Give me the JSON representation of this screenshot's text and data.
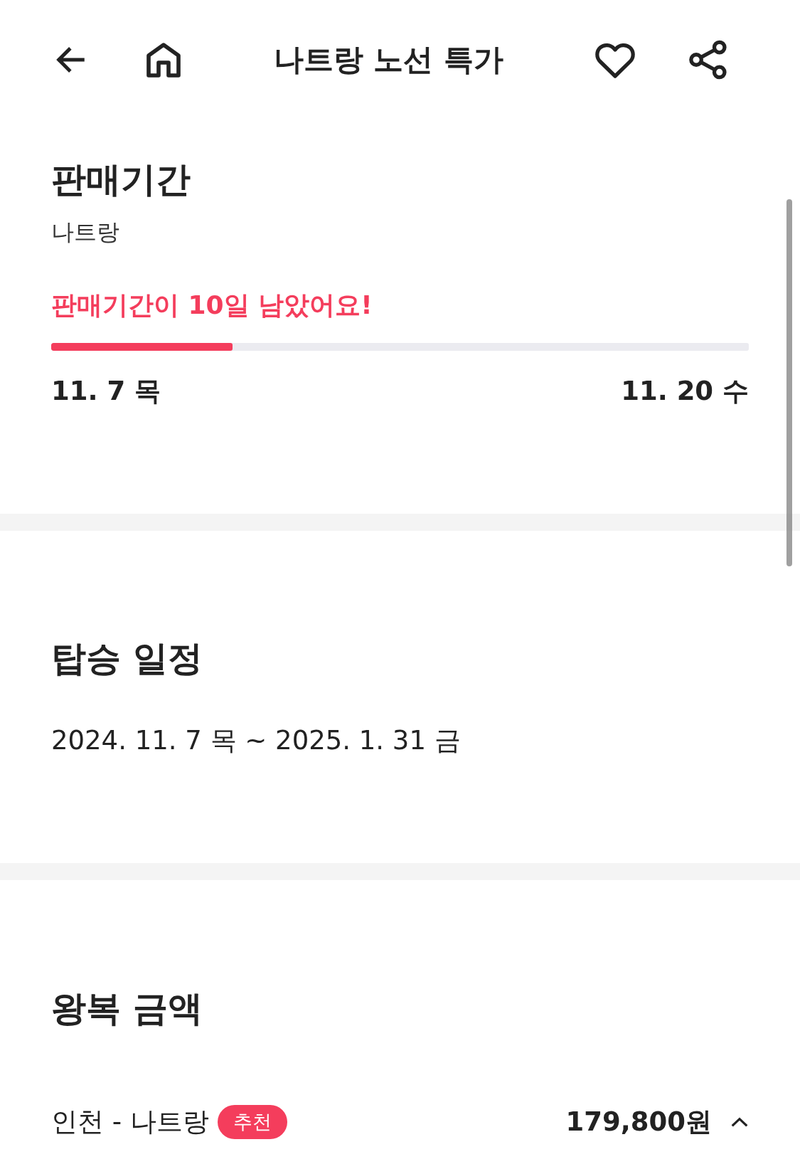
{
  "header": {
    "title": "나트랑 노선 특가"
  },
  "sale_period": {
    "heading": "판매기간",
    "subtitle": "나트랑",
    "notice": "판매기간이 10일 남았어요!",
    "level": 0.26,
    "start": "11. 7 목",
    "end": "11. 20 수"
  },
  "boarding_schedule": {
    "heading": "탑승 일정",
    "range": "2024. 11. 7 목 ~ 2025. 1. 31 금"
  },
  "round_trip_fare": {
    "heading": "왕복 금액",
    "routes": [
      {
        "route": "인천 - 나트랑",
        "badge": "추천",
        "price": "179,800원",
        "expanded": true
      }
    ]
  }
}
